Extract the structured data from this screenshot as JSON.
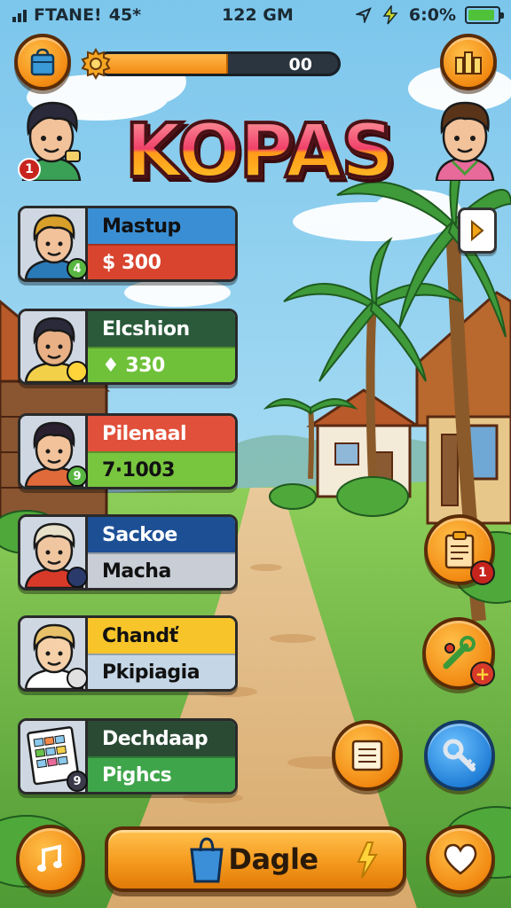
{
  "status_bar": {
    "carrier": "FTANE!",
    "network": "45*",
    "time": "122 GM",
    "battery_percent": "6:0%",
    "battery_fill": 0.9
  },
  "top_bar": {
    "progress_value": "00",
    "progress_fraction": 0.54
  },
  "game_title": "KOPAS",
  "player_avatar": {
    "badge": "1"
  },
  "characters": [
    {
      "name": "Mastup",
      "value": "$ 300",
      "badge": "4",
      "top_color": "#3a8fd4",
      "bottom_color": "#d9442e",
      "name_color": "#111111",
      "value_color": "#ffffff",
      "badge_color": "#59b642"
    },
    {
      "name": "Elcshion",
      "value": "♦ 330",
      "badge": "",
      "top_color": "#2a5a3a",
      "bottom_color": "#6fc13a",
      "name_color": "#ffffff",
      "value_color": "#ffffff",
      "badge_color": "#ffd43a"
    },
    {
      "name": "Pilenaal",
      "value": "7·1003",
      "badge": "9",
      "top_color": "#e0503a",
      "bottom_color": "#78c53e",
      "name_color": "#ffffff",
      "value_color": "#111111",
      "badge_color": "#59b642"
    },
    {
      "name": "Sackoe",
      "value": "Macha",
      "badge": "",
      "top_color": "#1d4f95",
      "bottom_color": "#c8cdd6",
      "name_color": "#ffffff",
      "value_color": "#111111",
      "badge_color": "#2a3a6a"
    },
    {
      "name": "Chandť",
      "value": "Pkipiagia",
      "badge": "",
      "top_color": "#f7c52a",
      "bottom_color": "#c5d6e6",
      "name_color": "#111111",
      "value_color": "#111111",
      "badge_color": "#e0e0e0"
    },
    {
      "name": "Dechdaap",
      "value": "Pighcs",
      "badge": "9",
      "top_color": "#2a4a34",
      "bottom_color": "#3fa54a",
      "name_color": "#ffffff",
      "value_color": "#ffffff",
      "badge_color": "#3a3a4a"
    }
  ],
  "side_buttons": {
    "quests_badge": "1"
  },
  "bottom_bar": {
    "play_label": "Dagle"
  },
  "colors": {
    "orange": "#f28a12",
    "dark_outline": "#5a2c08",
    "blue_button": "#2280d8"
  },
  "icons": [
    "bag-icon",
    "gear-icon",
    "stats-icon",
    "chevron-right-icon",
    "clipboard-icon",
    "wrench-icon",
    "document-icon",
    "key-icon",
    "music-icon",
    "shopping-bag-icon",
    "heart-icon"
  ]
}
